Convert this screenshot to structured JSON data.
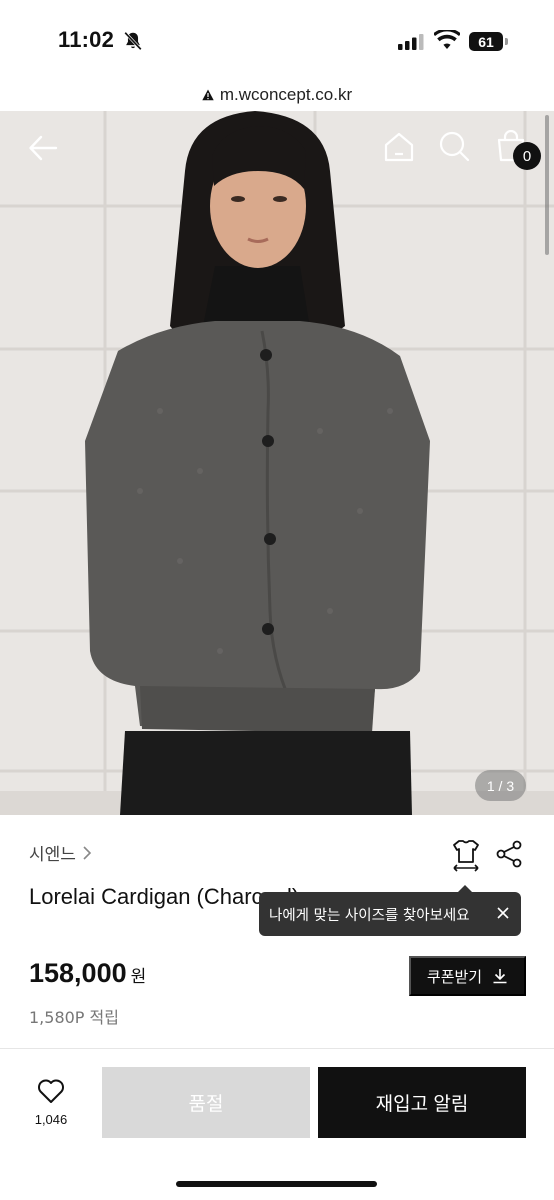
{
  "status_bar": {
    "time": "11:02",
    "battery": "61"
  },
  "browser": {
    "url": "m.wconcept.co.kr"
  },
  "hero": {
    "cart_count": "0",
    "page_indicator": "1 / 3"
  },
  "product": {
    "brand": "시엔느",
    "name": "Lorelai Cardigan (Ch",
    "name_hidden_tail": "arcoal)",
    "price": "158,000",
    "currency": "원",
    "points": "1,580P 적립",
    "coupon_label": "쿠폰받기"
  },
  "tooltip": {
    "text": "나에게 맞는 사이즈를 찾아보세요"
  },
  "bottom_bar": {
    "wish_count": "1,046",
    "soldout_label": "품절",
    "restock_label": "재입고 알림"
  },
  "colors": {
    "accent": "#111111",
    "disabled": "#d9d9d9",
    "tooltip": "#333333"
  }
}
